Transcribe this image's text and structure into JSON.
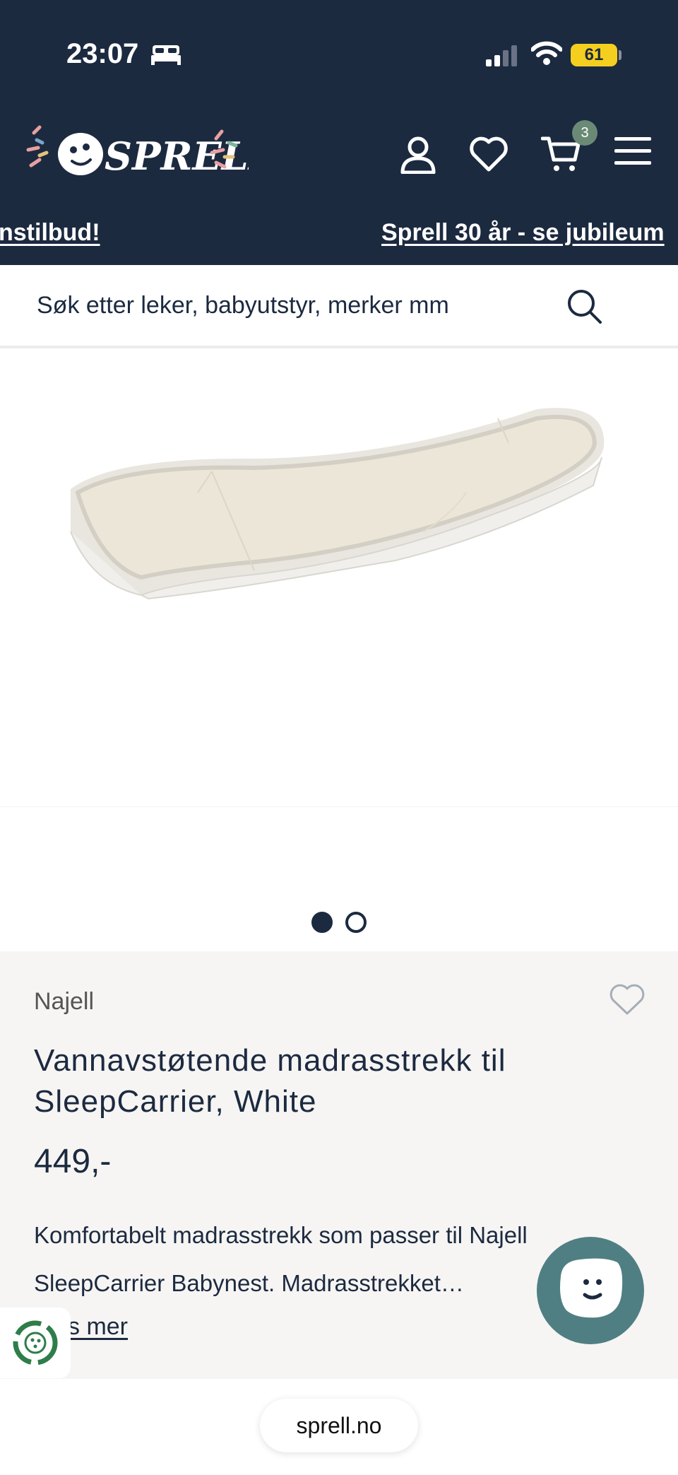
{
  "status_bar": {
    "time": "23:07",
    "battery": "61"
  },
  "header": {
    "cart_count": "3"
  },
  "ticker": {
    "left_text": "nstilbud!",
    "right_text": "Sprell 30 år - se jubileum"
  },
  "search": {
    "placeholder": "Søk etter leker, babyutstyr, merker mm"
  },
  "product": {
    "brand": "Najell",
    "title": "Vannavstøtende madrasstrekk til SleepCarrier, White",
    "price": "449,-",
    "description": "Komfortabelt madrasstrekk som passer til Najell SleepCarrier Babynest. Madrasstrekket…",
    "read_more": "s mer"
  },
  "browser": {
    "url": "sprell.no"
  },
  "colors": {
    "header_bg": "#1c2a40",
    "info_bg": "#f6f5f3",
    "chat_button": "#4f7f83",
    "cart_badge": "#6a8a76",
    "battery": "#f5cf1f"
  },
  "icons": [
    "bed-icon",
    "signal-icon",
    "wifi-icon",
    "user-icon",
    "heart-icon",
    "cart-icon",
    "menu-icon",
    "search-icon",
    "recycle-icon",
    "chat-face-icon"
  ]
}
